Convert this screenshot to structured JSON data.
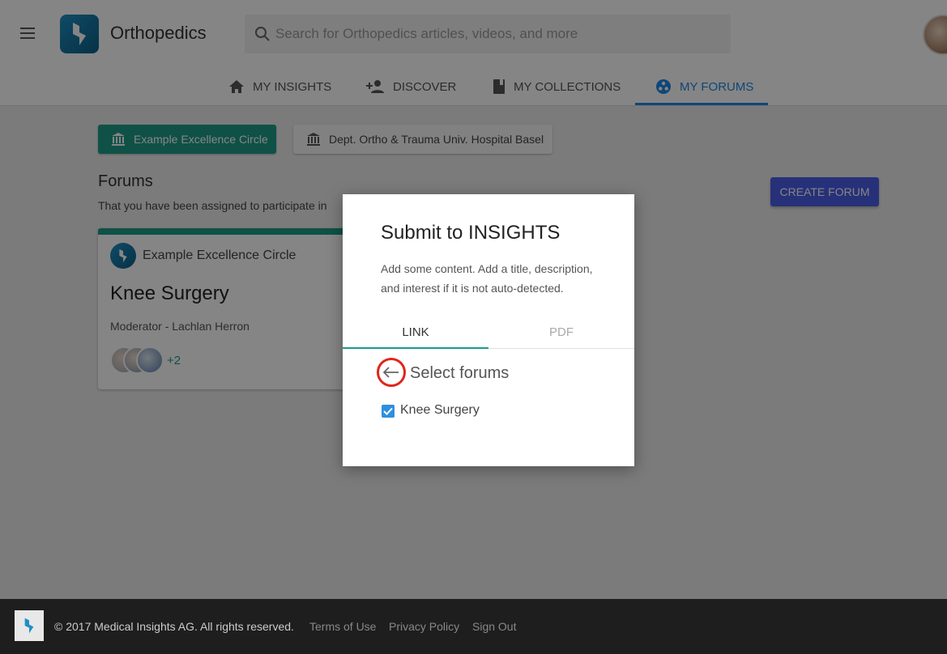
{
  "header": {
    "app_title": "Orthopedics",
    "search_placeholder": "Search for Orthopedics articles, videos, and more"
  },
  "tabs": [
    {
      "label": "MY INSIGHTS",
      "icon": "home-icon"
    },
    {
      "label": "DISCOVER",
      "icon": "add-person-icon"
    },
    {
      "label": "MY COLLECTIONS",
      "icon": "book-icon"
    },
    {
      "label": "MY FORUMS",
      "icon": "forums-icon",
      "active": true
    }
  ],
  "groups": [
    {
      "label": "Example Excellence Circle",
      "selected": true
    },
    {
      "label": "Dept. Ortho & Trauma Univ. Hospital Basel",
      "selected": false
    }
  ],
  "forums_section": {
    "title": "Forums",
    "subtitle": "That you have been assigned to participate in",
    "create_button": "CREATE FORUM"
  },
  "forum_card": {
    "group": "Example Excellence Circle",
    "title": "Knee Surgery",
    "moderator": "Moderator - Lachlan Herron",
    "extra_members": "+2"
  },
  "modal": {
    "title": "Submit to INSIGHTS",
    "description": "Add some content. Add a title, description, and interest if it is not auto-detected.",
    "tabs": {
      "link": "LINK",
      "pdf": "PDF"
    },
    "select_label": "Select forums",
    "forum_option": {
      "label": "Knee Surgery",
      "checked": true
    }
  },
  "footer": {
    "copyright": "© 2017 Medical Insights AG. All rights reserved.",
    "links": [
      "Terms of Use",
      "Privacy Policy",
      "Sign Out"
    ]
  },
  "colors": {
    "teal": "#1d9c88",
    "blue": "#1e88e5",
    "indigo": "#4a5ee8",
    "highlight_red": "#e1251b"
  }
}
